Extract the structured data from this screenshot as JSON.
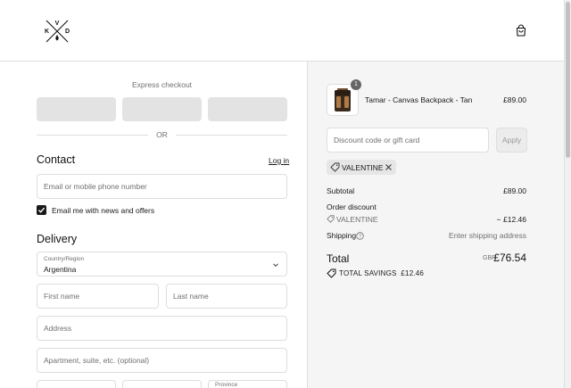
{
  "header": {
    "logo_text": "KVD",
    "cart_icon": "shopping-bag-icon"
  },
  "express": {
    "label": "Express checkout",
    "or_label": "OR"
  },
  "contact": {
    "heading": "Contact",
    "login_label": "Log in",
    "email_placeholder": "Email or mobile phone number",
    "newsletter_label": "Email me with news and offers",
    "newsletter_checked": true
  },
  "delivery": {
    "heading": "Delivery",
    "country_label": "Country/Region",
    "country_value": "Argentina",
    "first_name_placeholder": "First name",
    "last_name_placeholder": "Last name",
    "address_placeholder": "Address",
    "apartment_placeholder": "Apartment, suite, etc. (optional)",
    "province_label": "Province"
  },
  "summary": {
    "item": {
      "name": "Tamar - Canvas Backpack - Tan",
      "price": "£89.00",
      "quantity": "1"
    },
    "discount_placeholder": "Discount code or gift card",
    "apply_label": "Apply",
    "applied_code": "VALENTINE",
    "subtotal_label": "Subtotal",
    "subtotal_value": "£89.00",
    "order_discount_label": "Order discount",
    "discount_code_label": "VALENTINE",
    "discount_value": "− £12.46",
    "shipping_label": "Shipping",
    "shipping_value": "Enter shipping address",
    "total_label": "Total",
    "total_currency": "GBP",
    "total_value": "£76.54",
    "savings_label": "TOTAL SAVINGS",
    "savings_value": "£12.46"
  }
}
